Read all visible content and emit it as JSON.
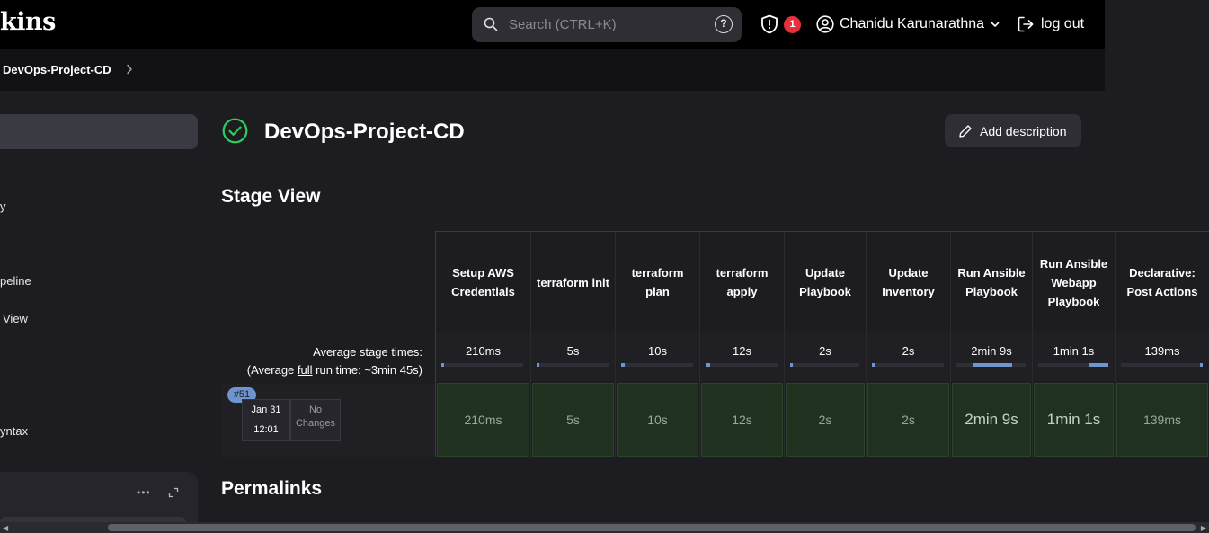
{
  "header": {
    "logo": "kins",
    "search_placeholder": "Search (CTRL+K)",
    "help": "?",
    "notification_count": "1",
    "user_name": "Chanidu Karunarathna",
    "logout_label": "log out"
  },
  "breadcrumb": {
    "item": "DevOps-Project-CD"
  },
  "sidebar": {
    "items": [
      {
        "label": "y"
      },
      {
        "label": "peline"
      },
      {
        "label": "View"
      },
      {
        "label": "yntax"
      }
    ],
    "panel_dots": "•••"
  },
  "main": {
    "title": "DevOps-Project-CD",
    "add_description": "Add description",
    "stage_view_heading": "Stage View",
    "permalinks_heading": "Permalinks"
  },
  "stage_view": {
    "avg_label_line1": "Average stage times:",
    "avg_label_prefix": "(Average ",
    "avg_label_full": "full",
    "avg_label_suffix": " run time: ~3min 45s)",
    "stages": [
      {
        "name": "Setup AWS Credentials",
        "avg": "210ms",
        "bar_fraction": 0.0
      },
      {
        "name": "terraform init",
        "avg": "5s",
        "bar_fraction": 0.02
      },
      {
        "name": "terraform plan",
        "avg": "10s",
        "bar_fraction": 0.05
      },
      {
        "name": "terraform apply",
        "avg": "12s",
        "bar_fraction": 0.06
      },
      {
        "name": "Update Playbook",
        "avg": "2s",
        "bar_fraction": 0.01
      },
      {
        "name": "Update Inventory",
        "avg": "2s",
        "bar_fraction": 0.01
      },
      {
        "name": "Run Ansible Playbook",
        "avg": "2min 9s",
        "bar_fraction": 0.57
      },
      {
        "name": "Run Ansible Webapp Playbook",
        "avg": "1min 1s",
        "bar_fraction": 0.27
      },
      {
        "name": "Declarative: Post Actions",
        "avg": "139ms",
        "bar_fraction": 0.0
      }
    ],
    "build": {
      "number": "#51",
      "date": "Jan 31",
      "time": "12:01",
      "changes": "No Changes",
      "cells": [
        "210ms",
        "5s",
        "10s",
        "12s",
        "2s",
        "2s",
        "2min 9s",
        "1min 1s",
        "139ms"
      ]
    }
  }
}
